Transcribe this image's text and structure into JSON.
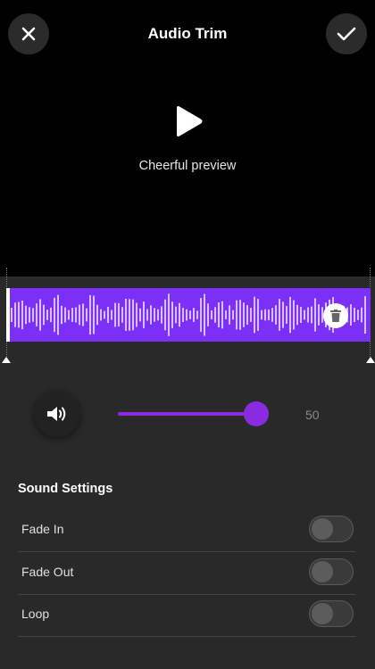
{
  "header": {
    "title": "Audio Trim",
    "close_icon": "close-icon",
    "confirm_icon": "check-icon"
  },
  "preview": {
    "label": "Cheerful preview",
    "play_icon": "play-icon"
  },
  "waveform": {
    "color": "#7b2ff7",
    "delete_icon": "trash-icon"
  },
  "volume": {
    "icon": "speaker-icon",
    "value": 50,
    "value_label": "50",
    "accent": "#8a2be2",
    "slider_fraction": 0.92
  },
  "sound_settings": {
    "title": "Sound Settings",
    "items": [
      {
        "label": "Fade In",
        "enabled": false
      },
      {
        "label": "Fade Out",
        "enabled": false
      },
      {
        "label": "Loop",
        "enabled": false
      }
    ]
  }
}
